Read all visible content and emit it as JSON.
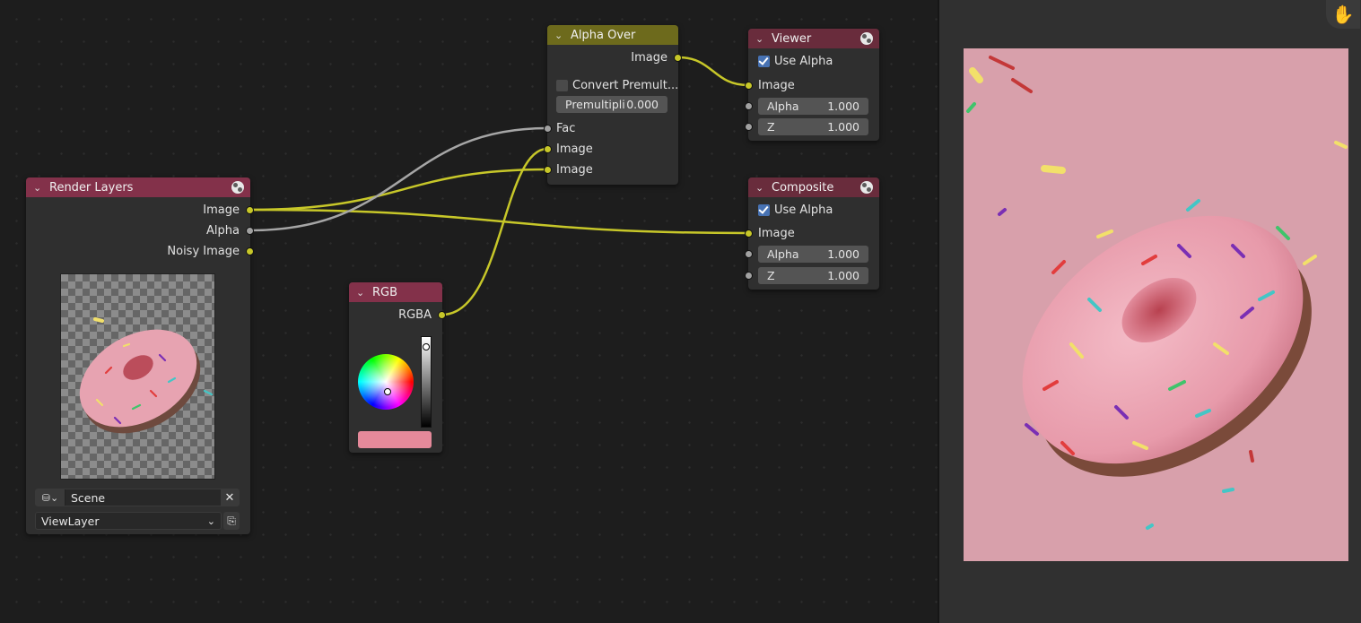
{
  "nodes": {
    "render_layers": {
      "title": "Render Layers",
      "outputs": [
        "Image",
        "Alpha",
        "Noisy Image"
      ],
      "scene": "Scene",
      "view_layer": "ViewLayer"
    },
    "rgb": {
      "title": "RGB",
      "output": "RGBA",
      "color": "#e5899a"
    },
    "alpha_over": {
      "title": "Alpha Over",
      "output": "Image",
      "convert_premultiplied_label": "Convert Premult...",
      "convert_premultiplied": false,
      "premultiply_label": "Premultipli",
      "premultiply_value": "0.000",
      "inputs": [
        "Fac",
        "Image",
        "Image"
      ]
    },
    "viewer": {
      "title": "Viewer",
      "use_alpha_label": "Use Alpha",
      "use_alpha": true,
      "input": "Image",
      "alpha_label": "Alpha",
      "alpha_value": "1.000",
      "z_label": "Z",
      "z_value": "1.000"
    },
    "composite": {
      "title": "Composite",
      "use_alpha_label": "Use Alpha",
      "use_alpha": true,
      "input": "Image",
      "alpha_label": "Alpha",
      "alpha_value": "1.000",
      "z_label": "Z",
      "z_value": "1.000"
    }
  },
  "colors": {
    "image_socket": "#c7c729",
    "value_socket": "#a1a1a1",
    "backdrop_pink": "#d9a0ac",
    "donut_pink": "#e8a6b4"
  },
  "icons": {
    "hand": "hand-icon",
    "globe": "globe-icon",
    "collapse": "chevron-down-icon",
    "scene": "scene-icon",
    "clear": "close-icon",
    "view_layer": "render-layer-icon"
  }
}
